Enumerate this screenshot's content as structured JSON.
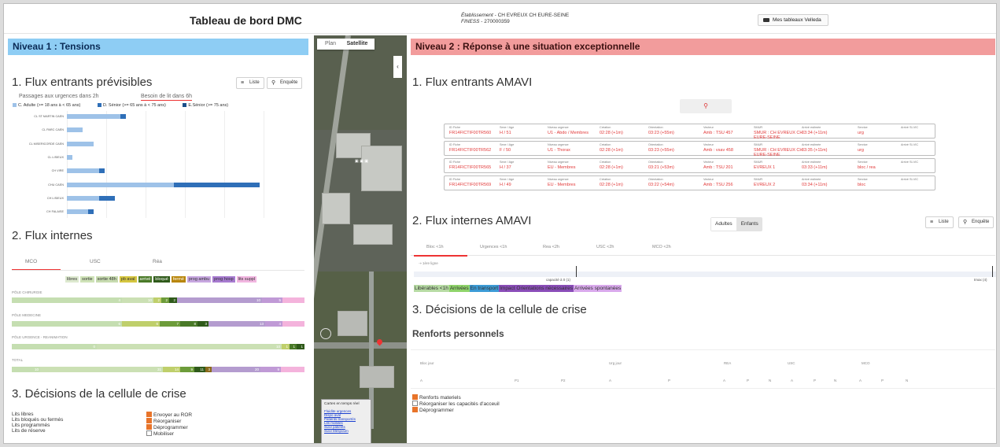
{
  "header": {
    "title": "Tableau de bord DMC",
    "etab_label": "Établissement",
    "etab_value": " - CH EVREUX CH EURE-SEINE",
    "finess_label": "FINESS",
    "finess_value": " - 270000359",
    "mes_tableaux": "Mes tableaux Velleda"
  },
  "left": {
    "level1": "Niveau 1 : Tensions",
    "s1": "1. Flux entrants prévisibles",
    "btn_liste": "Liste",
    "btn_enquete": "Enquête",
    "tab_a": "Passages aux urgences dans 2h",
    "tab_b": "Besoin de lit dans 6h",
    "leg_a": "C. Adulte (>= 18 ans à < 65 ans)",
    "leg_b": "D. Sénior (>= 65 ans à < 75 ans)",
    "leg_c": "E.Sénior (>= 75 ans)",
    "hospitals": [
      "CL ST MARTIN CAEN",
      "CL PARC CAEN",
      "CL MISERICORDE CAEN",
      "CL LISIEUX",
      "CH VIRE",
      "CHU CAEN",
      "CH LISIEUX",
      "CH FALAISE"
    ],
    "s2": "2. Flux internes",
    "sub_mco": "MCO",
    "sub_usc": "USC",
    "sub_rea": "Réa",
    "statuses": [
      "libres",
      "sortie",
      "sortie 48h",
      "pb aval",
      "arrivé",
      "bloqué",
      "fermé",
      "prog ambu",
      "prog hosp",
      "lits suppl"
    ],
    "poles": [
      "PÔLE CHIRURGIE",
      "PÔLE MEDECINE",
      "PÔLE URGENCE - REANIMATION",
      "TOTAL"
    ],
    "s3": "3. Décisions de la cellule de crise",
    "lits": [
      "Lits libres",
      "Lits bloqués ou fermés",
      "Lits programmés",
      "Lits de réserve"
    ],
    "actions": [
      {
        "label": "Envoyer au ROR",
        "checked": true
      },
      {
        "label": "Réorganiser",
        "checked": true
      },
      {
        "label": "Déprogrammer",
        "checked": true
      },
      {
        "label": "Mobiliser",
        "checked": false
      }
    ]
  },
  "map": {
    "plan": "Plan",
    "satellite": "Satellite",
    "collapse": "‹",
    "legend_title": "Cartes en temps réel",
    "legend_links": [
      "Fluidite urgences",
      "Dispo aval",
      "Patients transportés",
      "Lits mobiles",
      "Suivi patients",
      "Suivi Mespoum"
    ]
  },
  "right": {
    "level2": "Niveau 2 : Réponse à une situation exceptionnelle",
    "s1": "1. Flux entrants AMAVI",
    "fields": [
      "ID Fiche",
      "Sexe / Age",
      "Niveau urgence",
      "Création",
      "Orientation",
      "Vecteur",
      "SMUR",
      "Arrivé estimée",
      "Service",
      "Arrivé SI-VIC"
    ],
    "rows": [
      [
        "FR14FICTIF00TR560",
        "H / 51",
        "U1 - Abdo / Membres",
        "02:28 (+1m)",
        "03:23 (+55m)",
        "Amb : TSU 457",
        "SMUR : CH EVREUX CH EURE-SEINE",
        "03:34 (+11m)",
        "urg"
      ],
      [
        "FR14FICTIF00TR562",
        "F / 50",
        "U1 - Thorax",
        "02:28 (+1m)",
        "03:23 (+55m)",
        "Amb : vsav 458",
        "SMUR : CH EVREUX CH EURE-SEINE",
        "03:35 (+11m)",
        "urg"
      ],
      [
        "FR14FICTIF00TR565",
        "H / 37",
        "EU - Membres",
        "02:28 (+1m)",
        "03:21 (+53m)",
        "Amb : TSU 201",
        "EVREUX 1",
        "03:33 (+11m)",
        "bloc / rea"
      ],
      [
        "FR14FICTIF00TR569",
        "H / 49",
        "EU - Membres",
        "02:28 (+1m)",
        "03:22 (+54m)",
        "Amb : TSU 256",
        "EVREUX 2",
        "03:34 (+11m)",
        "bloc"
      ]
    ],
    "s2": "2. Flux internes AMAVI",
    "seg_adultes": "Adultes",
    "seg_enfants": "Enfants",
    "btn_liste": "Liste",
    "btn_enquete": "Enquête",
    "tabs": [
      "Bloc <1h",
      "Urgences <1h",
      "Rea <2h",
      "USC <2h",
      "MCO <2h"
    ],
    "first_line": "1ère ligne",
    "capacity": "capacité à 0 (1)",
    "tmax": "tmax (4)",
    "legend": [
      "Libérables <1h",
      "Arrivées",
      "En transport",
      "Impact Orientations nécessaires",
      "Arrivées spontanées"
    ],
    "s3": "3. Décisions de la cellule de crise",
    "renforts": "Renforts personnels",
    "cols": [
      "Bloc jour",
      "Urg jour",
      "REA",
      "USC",
      "MCO"
    ],
    "sub": [
      "A",
      "P1",
      "P2",
      "A",
      "P",
      "A",
      "P",
      "N",
      "A",
      "P",
      "N",
      "A",
      "P",
      "N"
    ],
    "checks": [
      {
        "label": "Renforts materiels",
        "checked": true
      },
      {
        "label": "Réorganiser les capacités d'acceuil",
        "checked": false
      },
      {
        "label": "Déprogrammer",
        "checked": true
      }
    ]
  },
  "chart_data": {
    "type": "bar",
    "categories": [
      "CL ST MARTIN CAEN",
      "CL PARC CAEN",
      "CL MISERICORDE CAEN",
      "CL LISIEUX",
      "CH VIRE",
      "CHU CAEN",
      "CH LISIEUX",
      "CH FALAISE"
    ],
    "series": [
      {
        "name": "C. Adulte (>= 18 ans à < 65 ans)",
        "values": [
          10,
          3,
          5,
          1,
          6,
          20,
          6,
          4
        ]
      },
      {
        "name": "D. Sénior (>= 65 ans à < 75 ans)",
        "values": [
          1,
          0,
          0,
          0,
          1,
          16,
          3,
          1
        ]
      },
      {
        "name": "E.Sénior (>= 75 ans)",
        "values": [
          0,
          0,
          0,
          0,
          0,
          0,
          0,
          0
        ]
      }
    ],
    "colors": [
      "#9ec2e8",
      "#2f6fb8",
      "#1b4f8a"
    ]
  }
}
